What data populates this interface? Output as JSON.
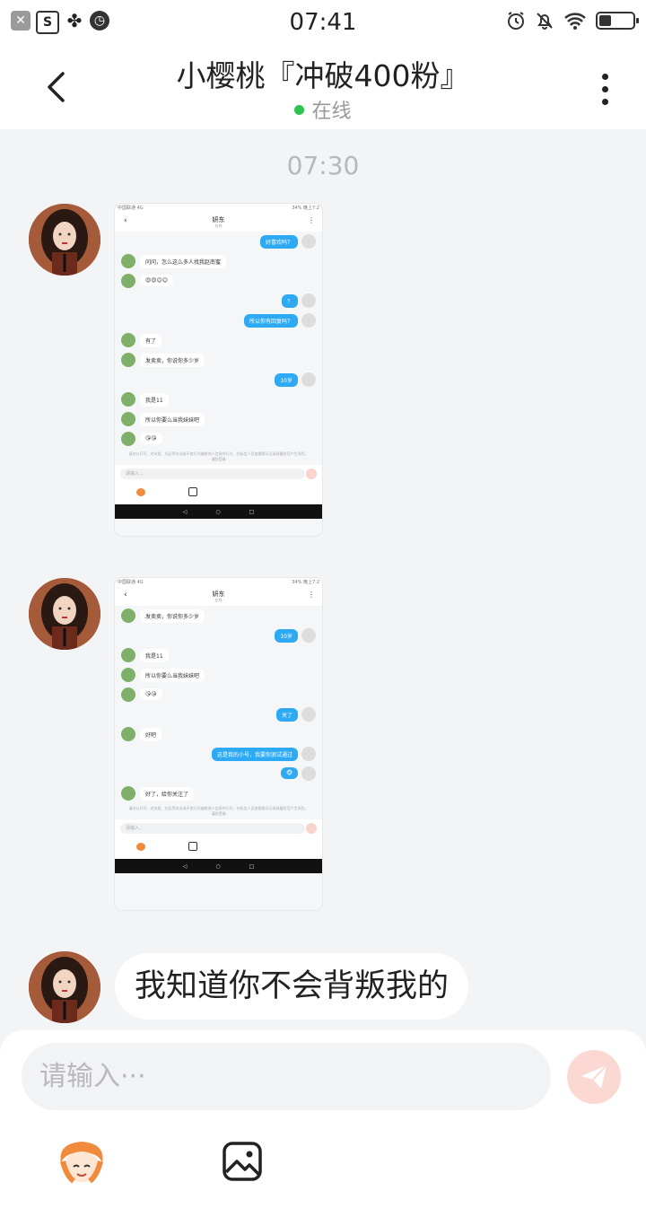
{
  "status_bar": {
    "time": "07:41",
    "left_icons": [
      "close-box-icon",
      "s-app-icon",
      "pinwheel-icon",
      "alarm-icon"
    ],
    "right_icons": [
      "alarm-clock-icon",
      "bell-off-icon",
      "wifi-icon",
      "battery-icon"
    ],
    "battery_level": 0.35
  },
  "header": {
    "title": "小樱桃『冲破400粉』",
    "status_text": "在线",
    "status_color": "#2ec24e"
  },
  "chat": {
    "time_separator": "07:30",
    "messages": [
      {
        "type": "image",
        "screenshot": {
          "status_left": "中国联通 4G",
          "status_right": "34% 晚上7:2",
          "title": "妍东",
          "subtitle": "在线",
          "rows": [
            {
              "side": "right",
              "text": "好喜欢吗？"
            },
            {
              "side": "left",
              "text": "问问，怎么这么多人找我赵南蜜"
            },
            {
              "side": "left",
              "text": "😍😍😊😊"
            },
            {
              "side": "right",
              "text": "？"
            },
            {
              "side": "right",
              "text": "所以你有回复吗？"
            },
            {
              "side": "left",
              "text": "有了"
            },
            {
              "side": "left",
              "text": "发卖卖，你说你多少岁"
            },
            {
              "side": "right",
              "text": "10岁"
            },
            {
              "side": "left",
              "text": "我是11"
            },
            {
              "side": "left",
              "text": "所以你要么当我妹妹吧"
            },
            {
              "side": "left",
              "text": "😘😘"
            }
          ],
          "notice": "请勿以开号、对关组、社区等非法或不良行为骗取他人信息的行为，在私信人员查看聊天记录具备防范产生风险，谨防受骗",
          "input_placeholder": "请输入..."
        }
      },
      {
        "type": "image",
        "screenshot": {
          "status_left": "中国联通 4G",
          "status_right": "34% 晚上7:2",
          "title": "妍东",
          "subtitle": "在线",
          "rows": [
            {
              "side": "left",
              "text": "发卖卖，你说你多少岁"
            },
            {
              "side": "right",
              "text": "10岁"
            },
            {
              "side": "left",
              "text": "我是11"
            },
            {
              "side": "left",
              "text": "所以你要么当我妹妹吧"
            },
            {
              "side": "left",
              "text": "😘😘"
            },
            {
              "side": "right",
              "text": "关了"
            },
            {
              "side": "left",
              "text": "好吧"
            },
            {
              "side": "right",
              "text": "这是我的小号，我要你测试通过"
            },
            {
              "side": "right",
              "text": "🐵"
            },
            {
              "side": "left",
              "text": "好了，给你关注了"
            }
          ],
          "notice": "请勿以开号、对关组、社区等非法或不良行为骗取他人信息的行为，在私信人员查看聊天记录具备防范产生风险，谨防受骗",
          "input_placeholder": "请输入..."
        }
      },
      {
        "type": "text",
        "text": "我知道你不会背叛我的"
      }
    ]
  },
  "composer": {
    "placeholder": "请输入···",
    "send_color": "#fbd8d2",
    "icons": [
      "emoji-icon",
      "image-icon",
      "send-icon"
    ]
  }
}
